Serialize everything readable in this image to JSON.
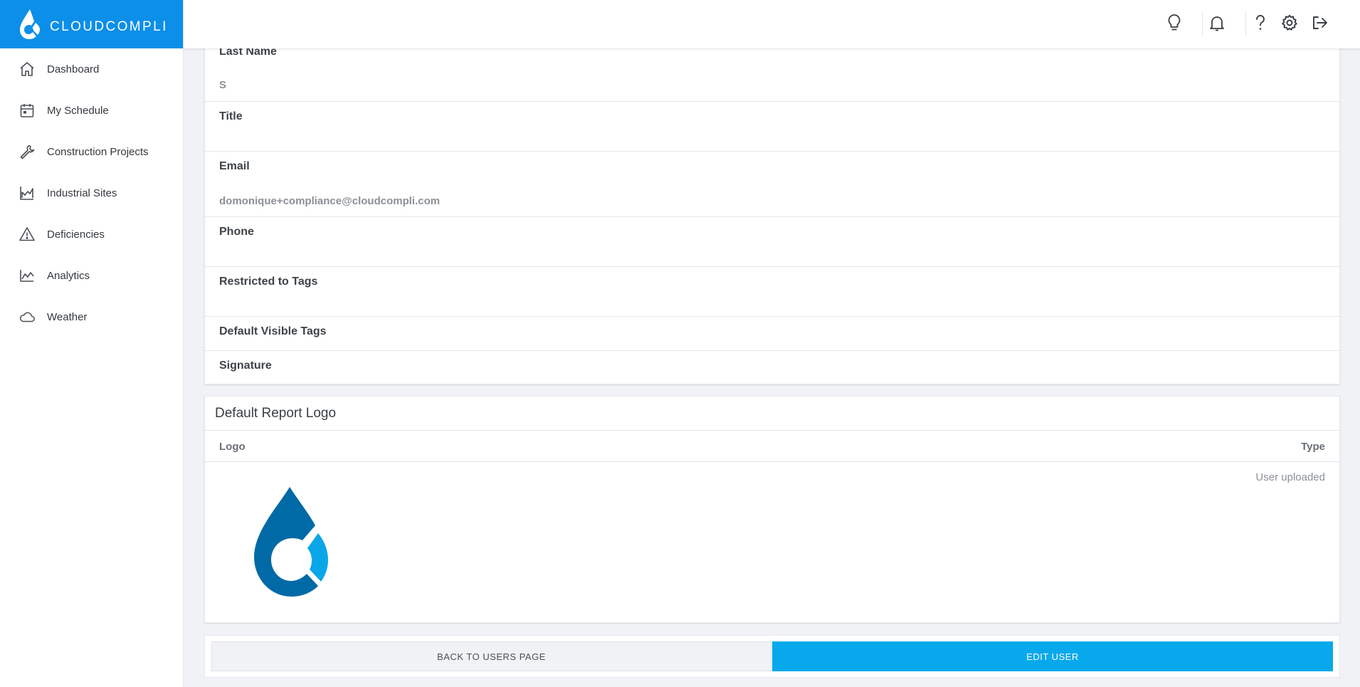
{
  "brand": {
    "name": "CLOUDCOMPLI"
  },
  "sidebar": {
    "items": [
      {
        "label": "Dashboard",
        "icon": "home-icon"
      },
      {
        "label": "My Schedule",
        "icon": "calendar-icon"
      },
      {
        "label": "Construction Projects",
        "icon": "wrench-icon"
      },
      {
        "label": "Industrial Sites",
        "icon": "factory-icon"
      },
      {
        "label": "Deficiencies",
        "icon": "warning-icon"
      },
      {
        "label": "Analytics",
        "icon": "area-chart-icon"
      },
      {
        "label": "Weather",
        "icon": "cloud-icon"
      }
    ]
  },
  "topbar": {
    "icons": [
      "lightbulb-icon",
      "bell-icon",
      "help-icon",
      "gear-icon",
      "logout-icon"
    ]
  },
  "user_details": {
    "last_name_label": "Last Name",
    "last_name_value": "S",
    "title_label": "Title",
    "title_value": "",
    "email_label": "Email",
    "email_value": "domonique+compliance@cloudcompli.com",
    "phone_label": "Phone",
    "phone_value": "",
    "restricted_tags_label": "Restricted to Tags",
    "default_visible_tags_label": "Default Visible Tags",
    "signature_label": "Signature"
  },
  "report_logo": {
    "title": "Default Report Logo",
    "col_logo": "Logo",
    "col_type": "Type",
    "type_value": "User uploaded"
  },
  "actions": {
    "back_label": "BACK TO USERS PAGE",
    "edit_label": "EDIT USER"
  },
  "colors": {
    "brand_blue": "#0b8fe8",
    "edit_button": "#08a8ec",
    "logo_dark": "#006aa6",
    "logo_light": "#0aa7e8"
  }
}
